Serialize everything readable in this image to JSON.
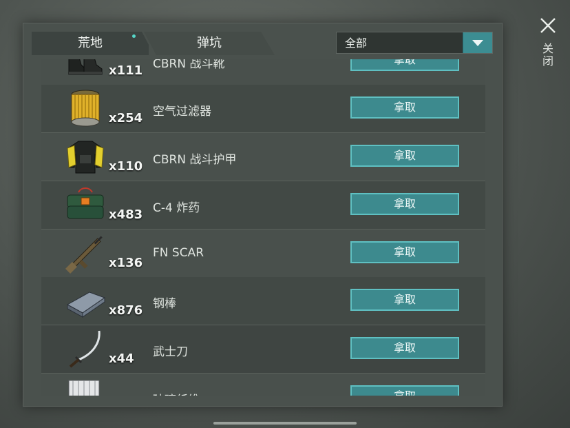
{
  "tabs": [
    {
      "label": "荒地"
    },
    {
      "label": "弹坑"
    }
  ],
  "filter": {
    "value": "全部"
  },
  "close_label": "关闭",
  "items": [
    {
      "qty": "x111",
      "name": "CBRN 战斗靴",
      "action": "拿取",
      "icon": "boots-icon"
    },
    {
      "qty": "x254",
      "name": "空气过滤器",
      "action": "拿取",
      "icon": "air-filter-icon"
    },
    {
      "qty": "x110",
      "name": "CBRN 战斗护甲",
      "action": "拿取",
      "icon": "armor-vest-icon"
    },
    {
      "qty": "x483",
      "name": "C-4 炸药",
      "action": "拿取",
      "icon": "explosive-icon"
    },
    {
      "qty": "x136",
      "name": "FN SCAR",
      "action": "拿取",
      "icon": "rifle-icon"
    },
    {
      "qty": "x876",
      "name": "钢棒",
      "action": "拿取",
      "icon": "steel-bar-icon"
    },
    {
      "qty": "x44",
      "name": "武士刀",
      "action": "拿取",
      "icon": "katana-icon"
    },
    {
      "qty": "",
      "name": "玻璃纤维",
      "action": "拿取",
      "icon": "fiberglass-icon"
    }
  ],
  "colors": {
    "accent": "#3d8a8e",
    "accent_border": "#5fc0c2",
    "tab_dot": "#56d6c8"
  }
}
